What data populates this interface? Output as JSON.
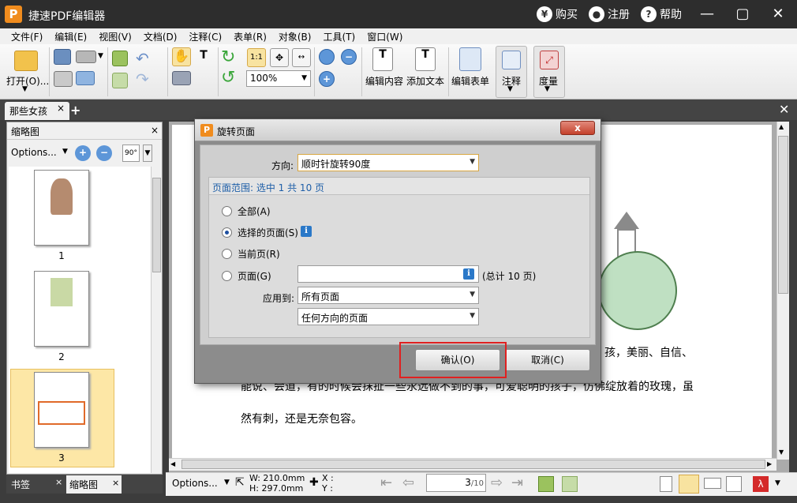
{
  "app": {
    "logo": "P",
    "title": "捷速PDF编辑器"
  },
  "titlebar": {
    "buy": "购买",
    "register": "注册",
    "help": "帮助",
    "buy_icon": "¥",
    "register_icon": "user-icon",
    "help_icon": "?"
  },
  "menu": [
    "文件(F)",
    "编辑(E)",
    "视图(V)",
    "文档(D)",
    "注释(C)",
    "表单(R)",
    "对象(B)",
    "工具(T)",
    "窗口(W)"
  ],
  "toolbar": {
    "open": "打开(O)...",
    "zoom": "100%",
    "fit_label": "1:1",
    "edit_content": "编辑内容",
    "add_text": "添加文本",
    "edit_form": "编辑表单",
    "annotate": "注释",
    "measure": "度量"
  },
  "tab": {
    "doc_name": "那些女孩",
    "close": "×",
    "add": "+"
  },
  "left_panel": {
    "title": "缩略图",
    "options": "Options...",
    "rotate_label": "90°",
    "thumbs": [
      "1",
      "2",
      "3"
    ],
    "selected": "3",
    "bottom_tabs": [
      "书签",
      "缩略图"
    ]
  },
  "document": {
    "line1_tail": "孩，美丽、自信、",
    "line2": "能说、会道，有的时候会抹扯一些永远做不到的事，可爱聪明的孩子，仿佛绽放着的玫瑰，虽",
    "line3": "然有刺，还是无奈包容。"
  },
  "statusbar": {
    "options": "Options...",
    "width": "W: 210.0mm",
    "height": "H: 297.0mm",
    "x": "X :",
    "y": "Y :",
    "page_current": "3",
    "page_total": "/10"
  },
  "dialog": {
    "title": "旋转页面",
    "close": "x",
    "direction_label": "方向:",
    "direction_value": "顺时针旋转90度",
    "range_header": "页面范围: 选中 1 共 10 页",
    "opt_all": "全部(A)",
    "opt_selected": "选择的页面(S)",
    "opt_current": "当前页(R)",
    "opt_pages": "页面(G)",
    "pages_input": "",
    "total_note": "(总计 10 页)",
    "apply_label": "应用到:",
    "apply_value": "所有页面",
    "orient_value": "任何方向的页面",
    "ok": "确认(O)",
    "cancel": "取消(C)"
  },
  "colors": {
    "titlebar": "#2d2d2d",
    "accent": "#f08c1e",
    "highlight": "#e02020",
    "link": "#1f5fa8"
  }
}
